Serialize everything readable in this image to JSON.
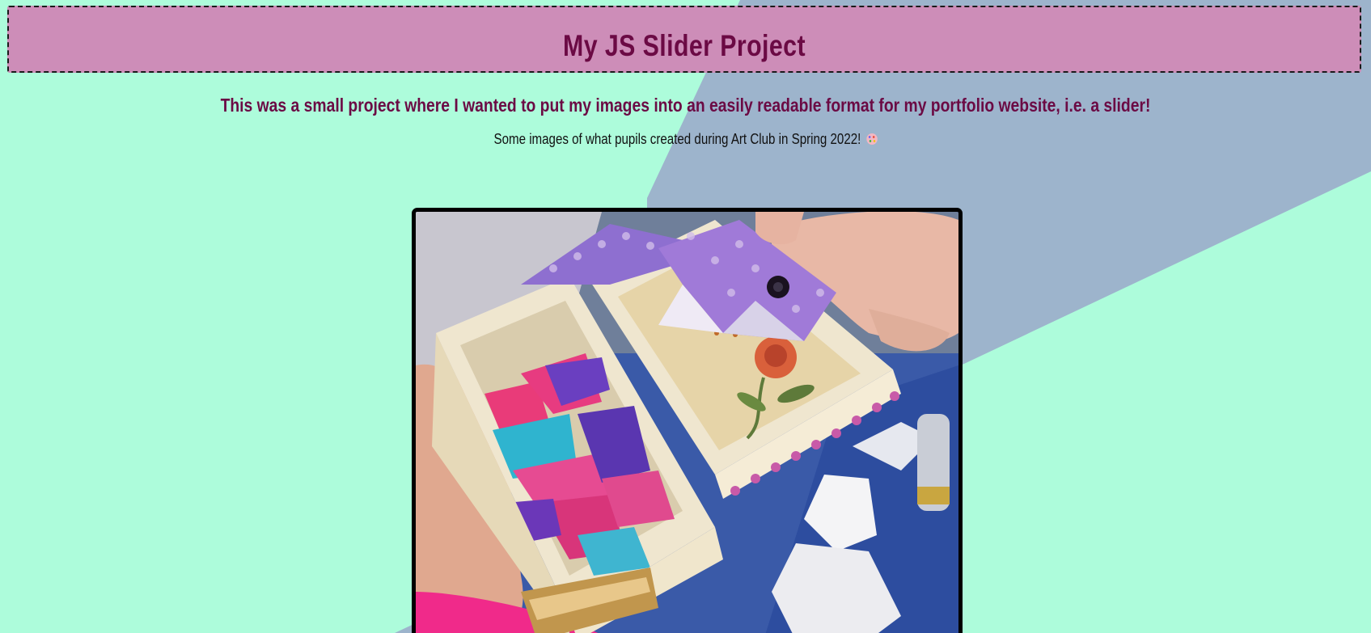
{
  "header": {
    "title": "My JS Slider Project"
  },
  "intro": {
    "text": "This was a small project where I wanted to put my images into an easily readable format for my portfolio website, i.e. a slider!"
  },
  "subtitle": {
    "text": "Some images of what pupils created during Art Club in Spring 2022!",
    "icon": "artist-palette-icon"
  },
  "slider": {
    "current_slide_icon": "slide-photo-origami-box"
  },
  "colors": {
    "page_background": "#adfcdb",
    "diagonal_band": "#9db4cc",
    "header_background": "#cd8db8",
    "title_color": "#6b0a44",
    "frame_border": "#000000"
  }
}
